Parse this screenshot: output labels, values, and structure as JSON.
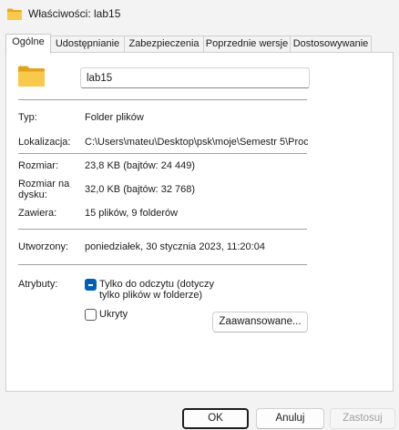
{
  "window": {
    "title": "Właściwości: lab15",
    "icon": "folder-icon"
  },
  "tabs": [
    {
      "label": "Ogólne",
      "active": true
    },
    {
      "label": "Udostępnianie",
      "active": false
    },
    {
      "label": "Zabezpieczenia",
      "active": false
    },
    {
      "label": "Poprzednie wersje",
      "active": false
    },
    {
      "label": "Dostosowywanie",
      "active": false
    }
  ],
  "general": {
    "name": "lab15",
    "type_label": "Typ:",
    "type_value": "Folder plików",
    "location_label": "Lokalizacja:",
    "location_value": "C:\\Users\\mateu\\Desktop\\psk\\moje\\Semestr 5\\Proc",
    "size_label": "Rozmiar:",
    "size_value": "23,8 KB (bajtów: 24 449)",
    "disk_size_label_1": "Rozmiar na",
    "disk_size_label_2": "dysku:",
    "disk_size_value": "32,0 KB (bajtów: 32 768)",
    "contains_label": "Zawiera:",
    "contains_value": "15 plików, 9 folderów",
    "created_label": "Utworzony:",
    "created_value": "poniedziałek, 30 stycznia 2023, 11:20:04",
    "attributes_label": "Atrybuty:",
    "readonly_label_1": "Tylko do odczytu (dotyczy",
    "readonly_label_2": "tylko plików w folderze)",
    "readonly_state": "mixed",
    "hidden_label": "Ukryty",
    "hidden_state": "unchecked",
    "advanced_button": "Zaawansowane..."
  },
  "buttons": {
    "ok": "OK",
    "cancel": "Anuluj",
    "apply": "Zastosuj"
  },
  "colors": {
    "accent": "#005fb8",
    "folder": "#f8c94a"
  }
}
